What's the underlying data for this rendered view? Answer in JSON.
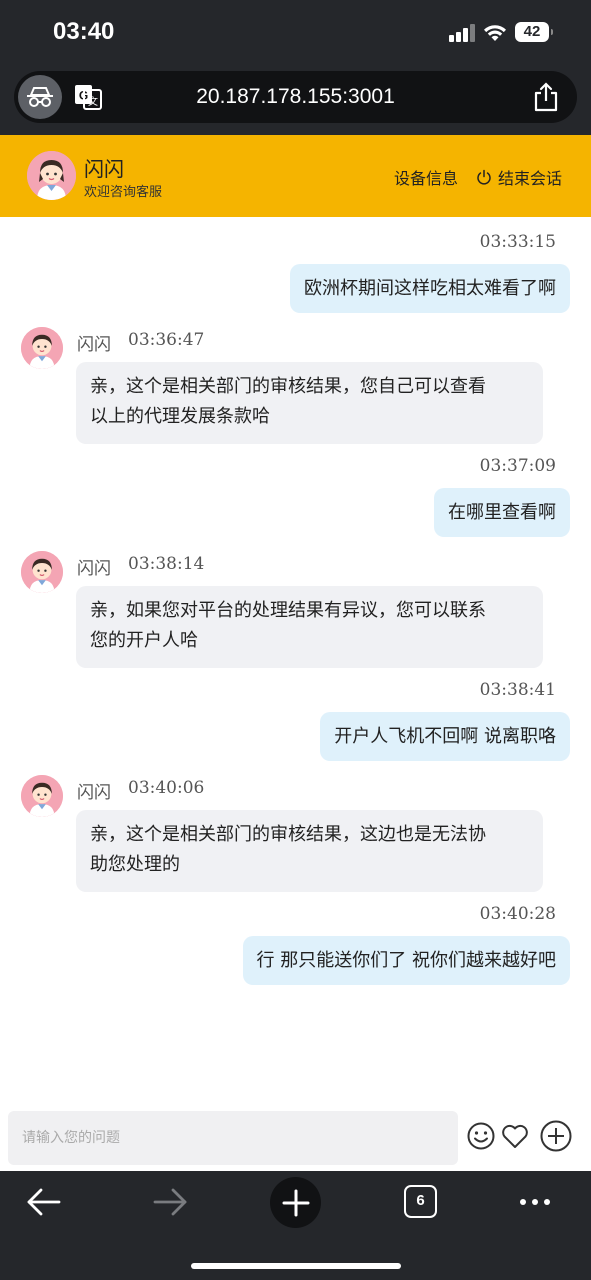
{
  "status_bar": {
    "time": "03:40",
    "battery": "42"
  },
  "browser": {
    "url": "20.187.178.155:3001",
    "tab_count": "6"
  },
  "header": {
    "agent_name": "闪闪",
    "agent_subtitle": "欢迎咨询客服",
    "device_info_label": "设备信息",
    "end_session_label": "结束会话",
    "background_color": "#f5b400"
  },
  "messages": [
    {
      "from": "user",
      "time": "03:33:15",
      "text": "欧洲杯期间这样吃相太难看了啊"
    },
    {
      "from": "agent",
      "name": "闪闪",
      "time": "03:36:47",
      "lines": [
        "亲，这个是相关部门的审核结果，您自己可以查看",
        "以上的代理发展条款哈"
      ]
    },
    {
      "from": "user",
      "time": "03:37:09",
      "text": "在哪里查看啊"
    },
    {
      "from": "agent",
      "name": "闪闪",
      "time": "03:38:14",
      "lines": [
        "亲，如果您对平台的处理结果有异议，您可以联系",
        "您的开户人哈"
      ]
    },
    {
      "from": "user",
      "time": "03:38:41",
      "text": "开户人飞机不回啊 说离职咯"
    },
    {
      "from": "agent",
      "name": "闪闪",
      "time": "03:40:06",
      "lines": [
        "亲，这个是相关部门的审核结果，这边也是无法协",
        "助您处理的"
      ]
    },
    {
      "from": "user",
      "time": "03:40:28",
      "text": "行 那只能送你们了 祝你们越来越好吧"
    }
  ],
  "input": {
    "placeholder": "请输入您的问题"
  },
  "icons": {
    "incognito": "incognito-icon",
    "translate": "translate-icon",
    "share": "share-icon",
    "power": "power-icon",
    "emoji": "emoji-icon",
    "heart": "heart-icon",
    "plus": "plus-circle-icon",
    "back": "arrow-left-icon",
    "forward": "arrow-right-icon",
    "new_tab": "plus-icon",
    "more": "more-dots-icon"
  },
  "colors": {
    "user_bubble": "#dff1fb",
    "agent_bubble": "#f0f1f4",
    "browser_chrome": "#25272b"
  }
}
